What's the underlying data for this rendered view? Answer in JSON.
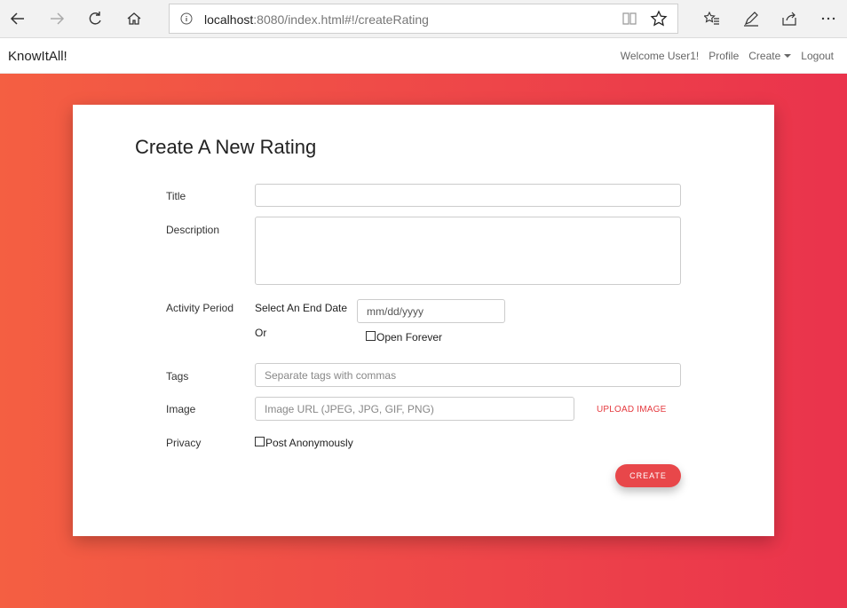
{
  "browser": {
    "url_host": "localhost",
    "url_rest": ":8080/index.html#!/createRating"
  },
  "navbar": {
    "brand": "KnowItAll!",
    "welcome": "Welcome User1!",
    "profile": "Profile",
    "create": "Create",
    "logout": "Logout"
  },
  "form": {
    "heading": "Create A New Rating",
    "title_label": "Title",
    "description_label": "Description",
    "activity_label": "Activity Period",
    "select_end_date": "Select An End Date",
    "or_text": "Or",
    "date_placeholder": "mm/dd/yyyy",
    "open_forever": "Open Forever",
    "tags_label": "Tags",
    "tags_placeholder": "Separate tags with commas",
    "image_label": "Image",
    "image_placeholder": "Image URL (JPEG, JPG, GIF, PNG)",
    "upload_label": "UPLOAD IMAGE",
    "privacy_label": "Privacy",
    "post_anonymously": "Post Anonymously",
    "create_button": "CREATE"
  },
  "colors": {
    "accent": "#e8474a",
    "gradient_start": "#f45f42",
    "gradient_end": "#ea334c"
  }
}
